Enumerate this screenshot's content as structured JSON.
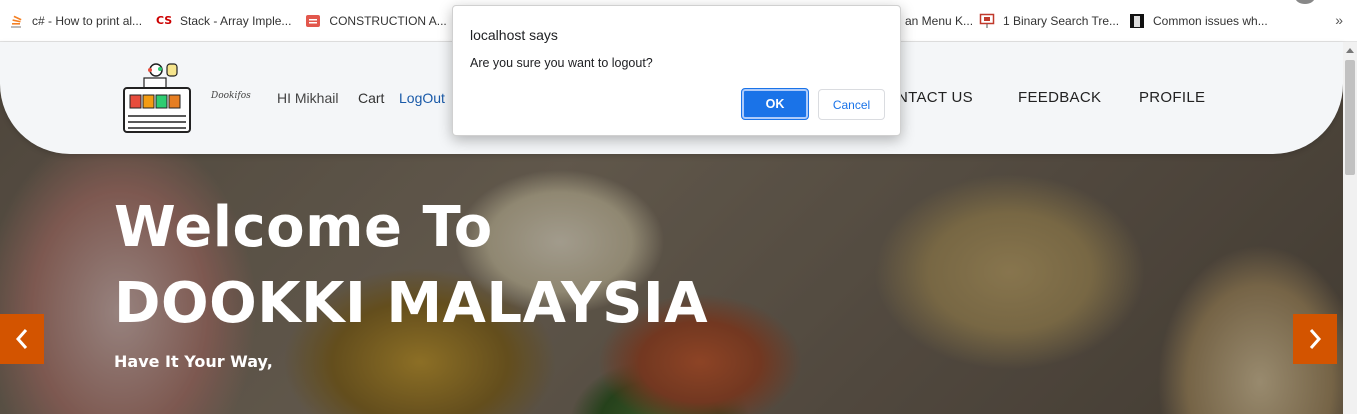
{
  "bookmarks": [
    {
      "icon": "stackoverflow-icon",
      "label": "c# - How to print al..."
    },
    {
      "icon": "cs-icon",
      "label": "Stack - Array Imple..."
    },
    {
      "icon": "construction-icon",
      "label": "CONSTRUCTION A..."
    },
    {
      "icon": "page-icon",
      "label": "an Menu K..."
    },
    {
      "icon": "presentation-icon",
      "label": "1 Binary Search Tre..."
    },
    {
      "icon": "building-icon",
      "label": "Common issues wh..."
    }
  ],
  "bookmarks_more": "»",
  "header": {
    "brand": "Dookifos",
    "greeting": "HI Mikhail",
    "cart": "Cart",
    "logout": "LogOut",
    "nav": [
      "ONTACT US",
      "FEEDBACK",
      "PROFILE"
    ]
  },
  "hero": {
    "title_line1": "Welcome To",
    "title_line2": "DOOKKI MALAYSIA",
    "subtitle": "Have It Your Way,"
  },
  "dialog": {
    "title": "localhost says",
    "message": "Are you sure you want to logout?",
    "ok_label": "OK",
    "cancel_label": "Cancel"
  },
  "colors": {
    "accent_orange": "#d35400",
    "dialog_blue": "#1a73e8",
    "logout_link": "#1a5aa8"
  }
}
